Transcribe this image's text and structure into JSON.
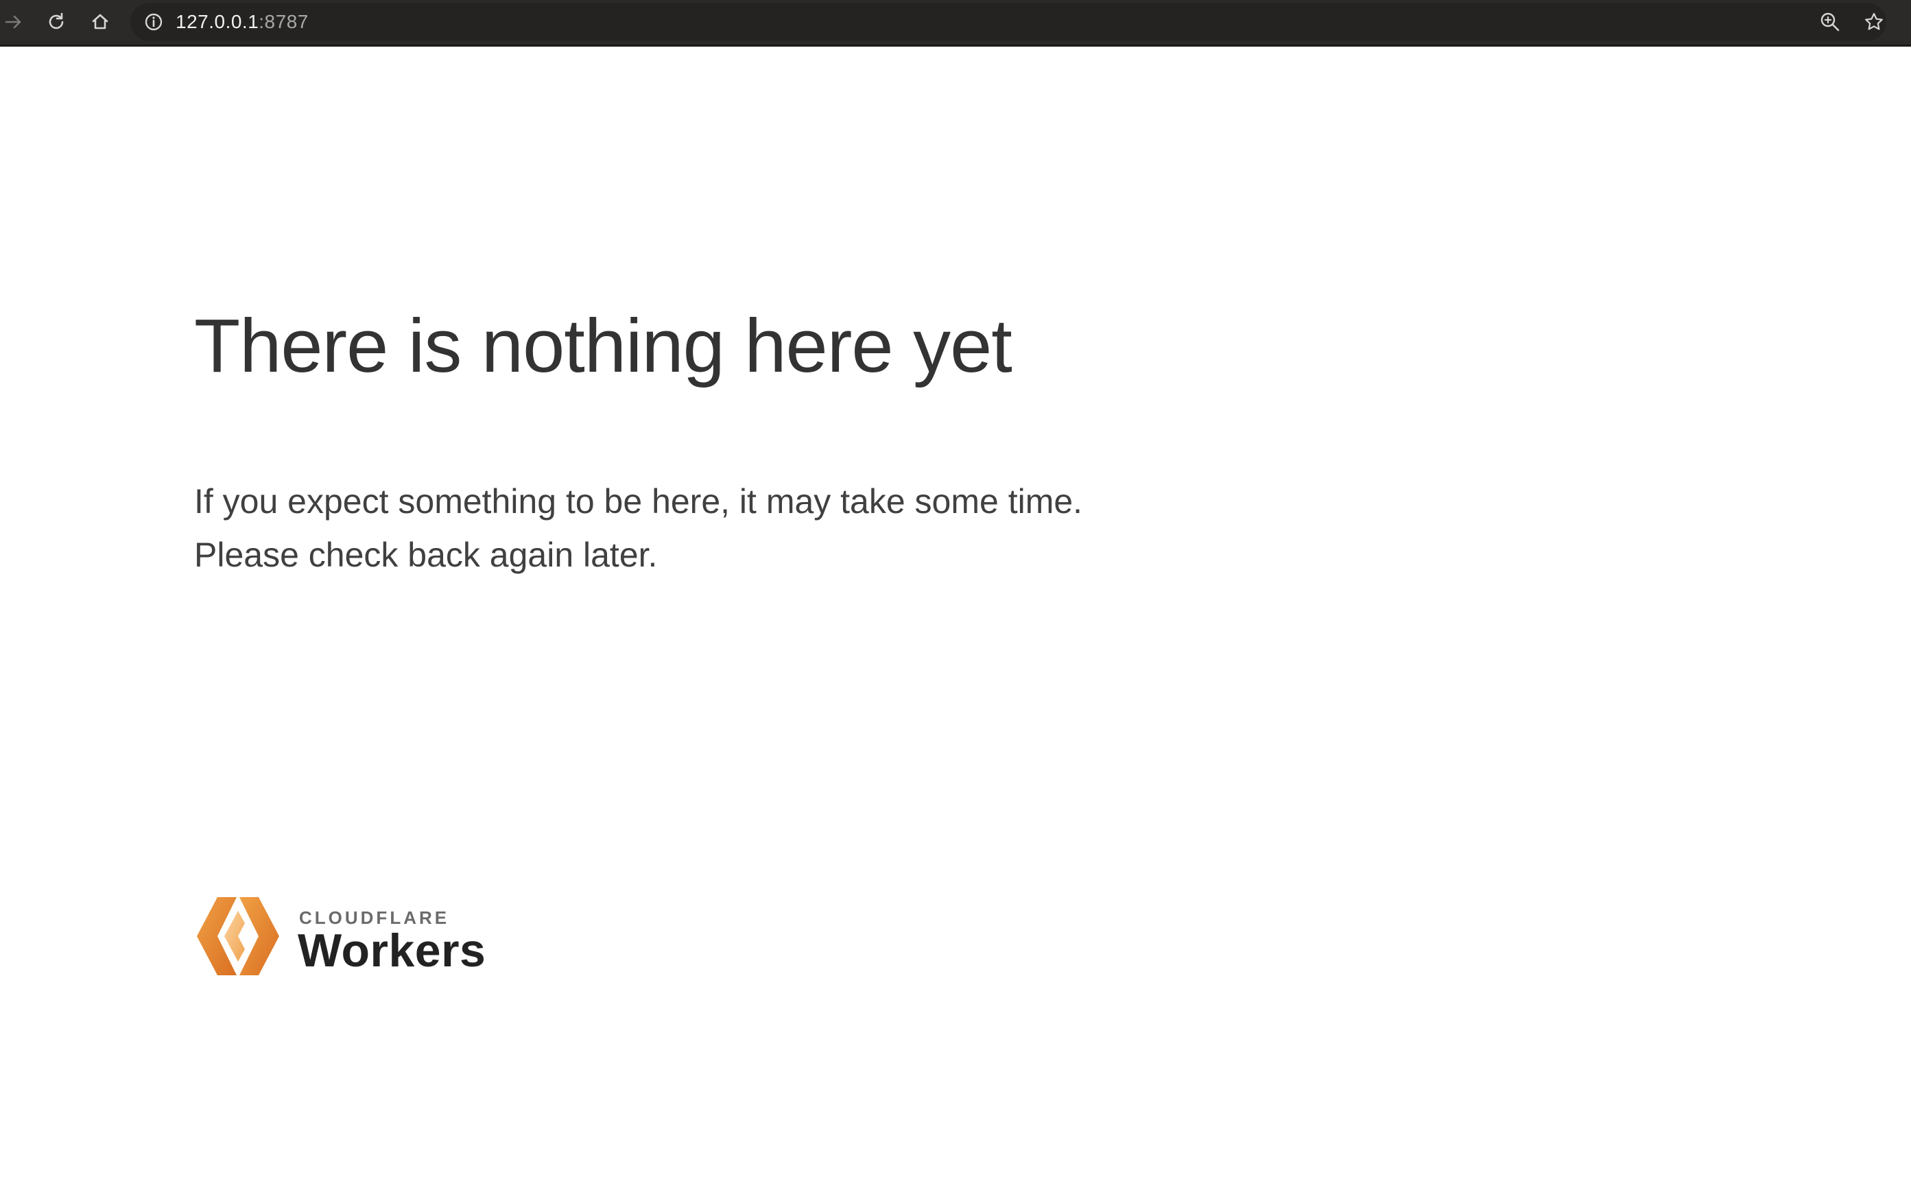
{
  "browser": {
    "url_host": "127.0.0.1",
    "url_port": ":8787",
    "colors": {
      "toolbar_bg": "#2b2a28",
      "icon": "#d6d6d6"
    },
    "icons": [
      "forward-icon",
      "reload-icon",
      "home-icon",
      "info-icon",
      "zoom-icon",
      "bookmark-star-icon"
    ]
  },
  "page": {
    "headline": "There is nothing here yet",
    "message_line1": "If you expect something to be here, it may take some time.",
    "message_line2": "Please check back again later."
  },
  "logo": {
    "brand": "CLOUDFLARE",
    "product": "Workers",
    "colors": {
      "orange_dark": "#e2822a",
      "orange_light": "#f5b870"
    }
  }
}
